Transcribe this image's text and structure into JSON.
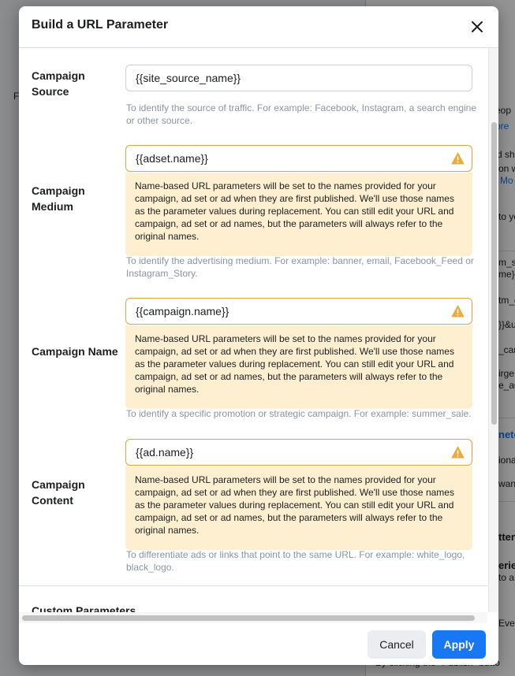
{
  "background": {
    "fragments": [
      "F",
      "eop",
      "ore",
      "d sh",
      "on w",
      "Mo",
      "to yo",
      "m_so",
      "me}}&",
      "tm_c",
      "}}&u",
      "_cam",
      "irge",
      "e_ad",
      "nete",
      "iona",
      "wan",
      "tten",
      "erie",
      "to a",
      "to a",
      "Even",
      "to a",
      "By clicking the \"Publish\" butto"
    ]
  },
  "dialog": {
    "title": "Build a URL Parameter",
    "close_icon": "close-icon",
    "fields": [
      {
        "label_lines": [
          "Campaign",
          "Source"
        ],
        "value": "{{site_source_name}}",
        "help": "To identify the source of traffic. For example: Facebook, Instagram, a search engine or other source."
      },
      {
        "label_lines": [
          "Campaign",
          "Medium"
        ],
        "value": "{{adset.name}}",
        "notice": "Name-based URL parameters will be set to the names provided for your campaign, ad set or ad when they are first published. We'll use those names as the parameter values during replacement. You can still edit your URL and campaign, ad set or ad names, but the parameters will always refer to the original names.",
        "help": "To identify the advertising medium. For example: banner, email, Facebook_Feed or Instagram_Story."
      },
      {
        "label_lines": [
          "Campaign Name"
        ],
        "value": "{{campaign.name}}",
        "notice": "Name-based URL parameters will be set to the names provided for your campaign, ad set or ad when they are first published. We'll use those names as the parameter values during replacement. You can still edit your URL and campaign, ad set or ad names, but the parameters will always refer to the original names.",
        "help": "To identify a specific promotion or strategic campaign. For example: summer_sale."
      },
      {
        "label_lines": [
          "Campaign",
          "Content"
        ],
        "value": "{{ad.name}}",
        "notice": "Name-based URL parameters will be set to the names provided for your campaign, ad set or ad when they are first published. We'll use those names as the parameter values during replacement. You can still edit your URL and campaign, ad set or ad names, but the parameters will always refer to the original names.",
        "help": "To differentiate ads or links that point to the same URL. For example: white_logo, black_logo."
      }
    ],
    "custom_parameters_label": "Custom Parameters",
    "cancel_label": "Cancel",
    "apply_label": "Apply"
  },
  "colors": {
    "accent": "#1877f2",
    "warning_border": "#e2a33a",
    "warning_icon": "#f0a93b",
    "notice_bg": "#fdefd0"
  }
}
